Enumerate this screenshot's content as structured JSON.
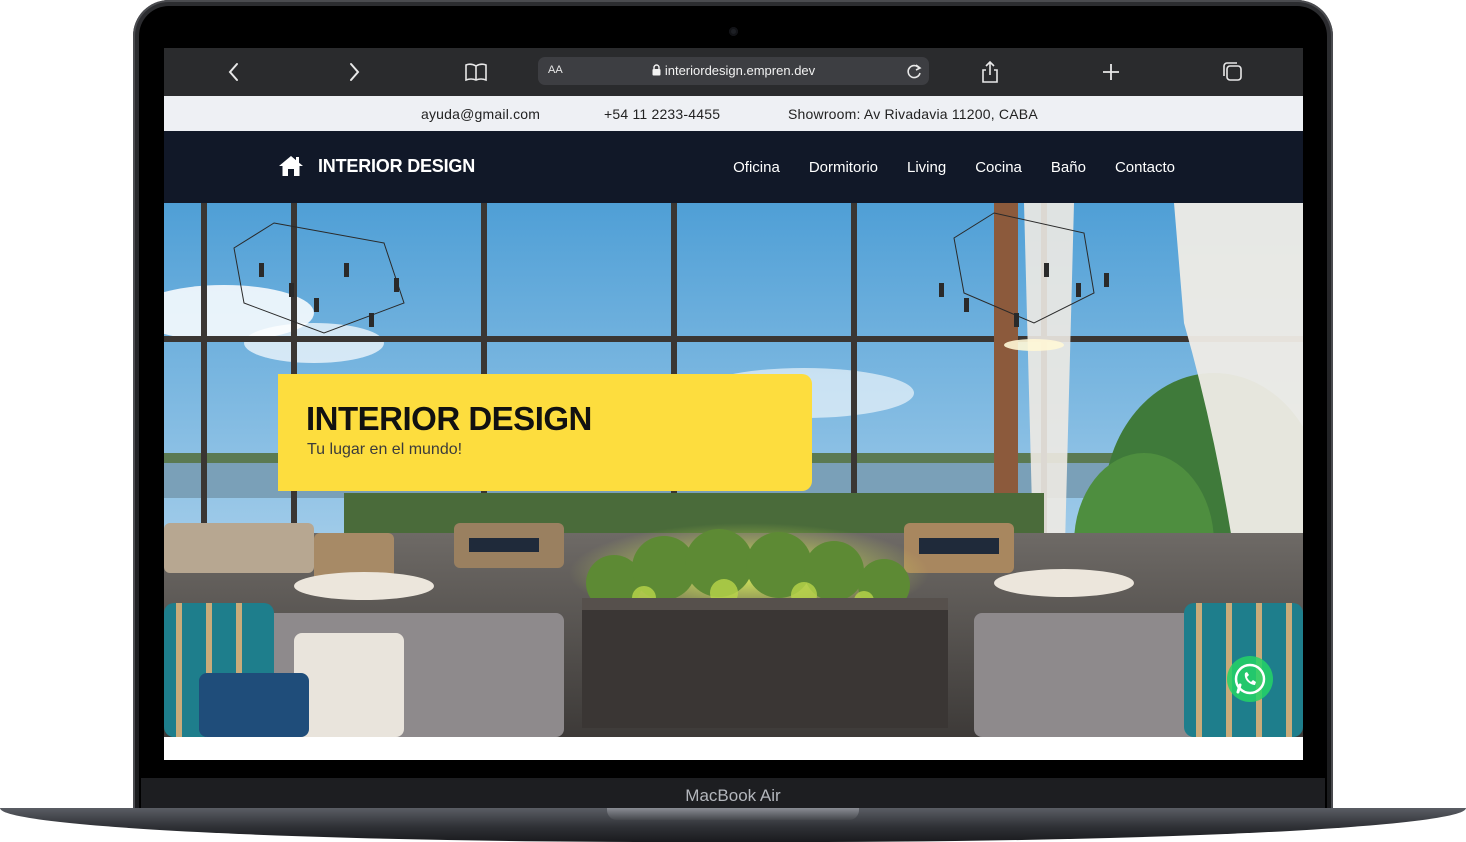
{
  "device": {
    "model_label": "MacBook Air"
  },
  "browser": {
    "url": "interiordesign.empren.dev",
    "reader_label": "AA",
    "icons": [
      "back-icon",
      "forward-icon",
      "book-icon",
      "lock-icon",
      "reload-icon",
      "share-icon",
      "plus-icon",
      "tabs-icon"
    ]
  },
  "topbar": {
    "email": "ayuda@gmail.com",
    "phone": "+54 11 2233-4455",
    "address": "Showroom: Av Rivadavia 11200, CABA"
  },
  "navbar": {
    "brand": "INTERIOR DESIGN",
    "brand_icon": "home-icon",
    "links": [
      "Oficina",
      "Dormitorio",
      "Living",
      "Cocina",
      "Baño",
      "Contacto"
    ]
  },
  "hero": {
    "title": "INTERIOR DESIGN",
    "subtitle": "Tu lugar en el mundo!",
    "card_color": "#fddd3e",
    "floating_button_icon": "whatsapp-icon"
  },
  "colors": {
    "navbar_bg": "#111828",
    "topbar_bg": "#eef0f4",
    "whatsapp": "#25d366"
  }
}
